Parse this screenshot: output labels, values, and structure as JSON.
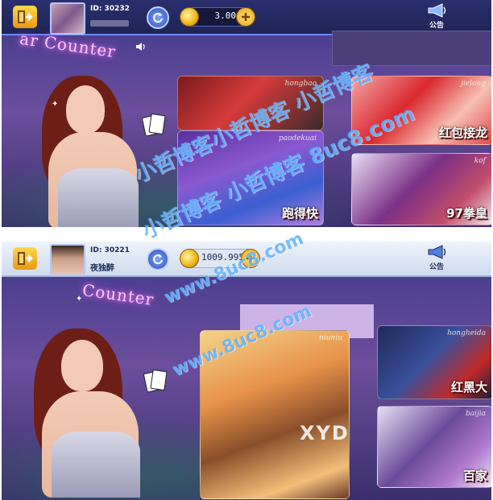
{
  "top_panel": {
    "user_id": "ID: 30232",
    "coins": "3.00",
    "notice_label": "公告",
    "counter_sign": "ar Counter",
    "games": [
      {
        "label": "",
        "tag": "hongbao"
      },
      {
        "label": "红包接龙",
        "tag": "jielong"
      },
      {
        "label": "跑得快",
        "tag": "paodekuai"
      },
      {
        "label": "97拳皇",
        "tag": "kof"
      }
    ]
  },
  "bottom_panel": {
    "user_id": "ID: 30221",
    "nickname": "夜独醉",
    "coins": "1009.995",
    "notice_label": "公告",
    "counter_sign": "Counter",
    "games": [
      {
        "label": "",
        "tag": "niuniu"
      },
      {
        "label": "红黑大",
        "tag": "hongheida"
      },
      {
        "label": "百家",
        "tag": "baijia"
      }
    ],
    "overlay_text": "XYD"
  },
  "watermarks": {
    "cn_line_1": "小哲博客小哲博客 小哲博客",
    "cn_line_2": "小哲博客 小哲博客 8uc8.com",
    "url_line_1": "www.8uc8.com",
    "url_line_2": "www.8uc8.com"
  },
  "colors": {
    "accent_blue": "#6c8cff",
    "coin_gold": "#f2b91e",
    "watermark_blue": "#50aaff",
    "mask_purple": "#cdb4e6"
  },
  "icons": {
    "exit": "exit-door-icon",
    "refresh": "refresh-icon",
    "coin": "gold-coin-icon",
    "add": "plus-icon",
    "notice": "megaphone-icon",
    "sound": "speaker-icon"
  }
}
